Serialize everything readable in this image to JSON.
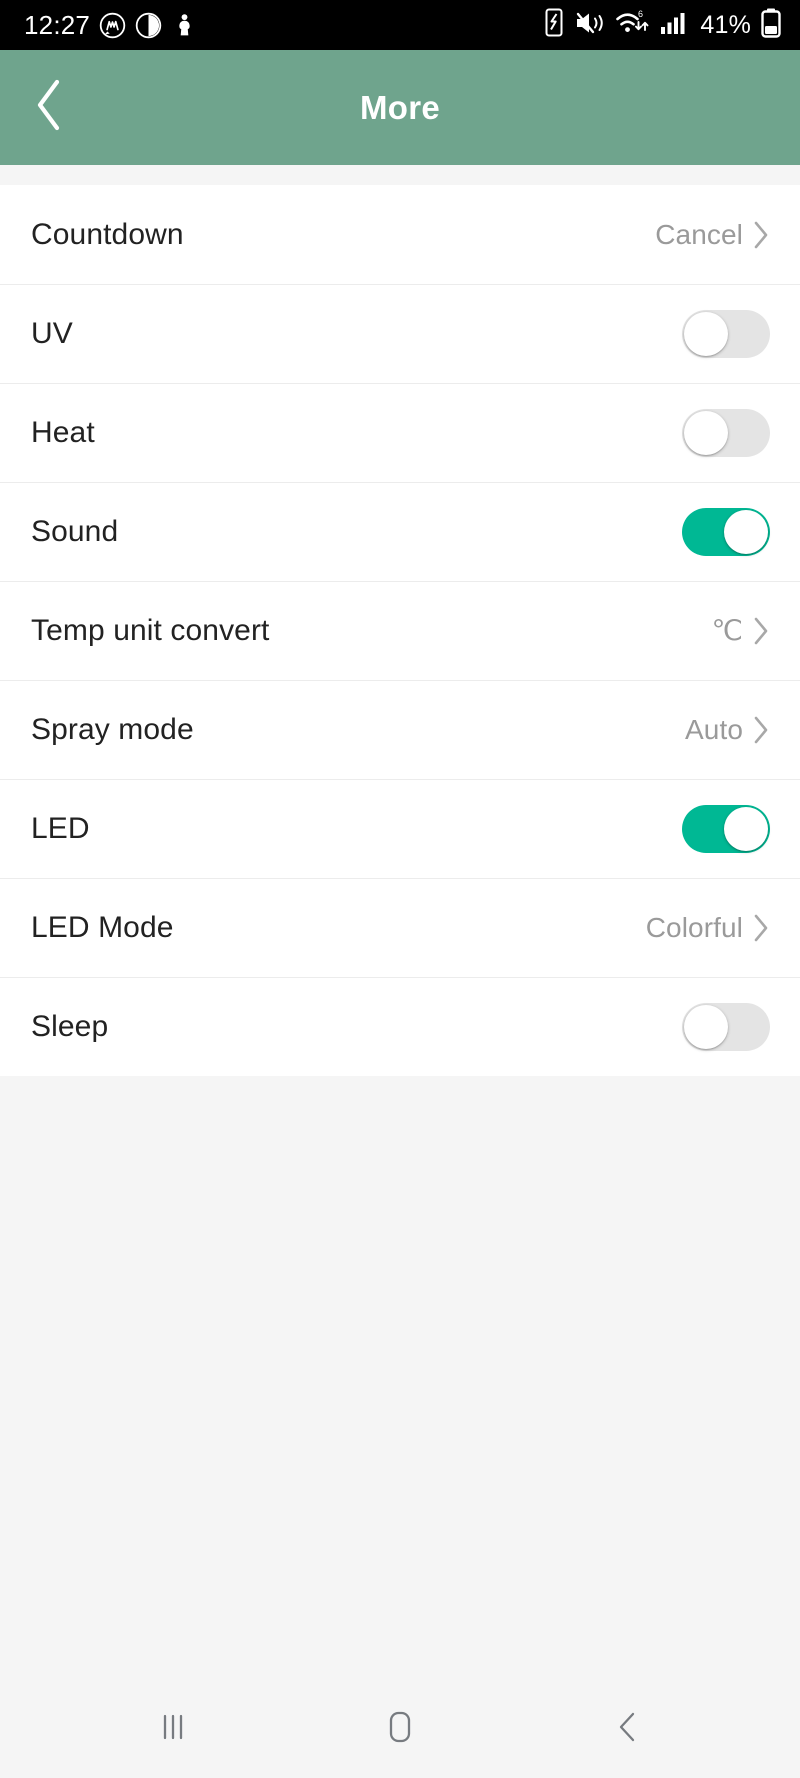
{
  "status_bar": {
    "time": "12:27",
    "battery_percent": "41%",
    "left_icons": [
      "whatsapp-icon",
      "moon-icon",
      "person-icon"
    ],
    "right_icons": [
      "nfc-icon",
      "mute-vibrate-icon",
      "wifi-icon",
      "signal-icon",
      "battery-icon"
    ]
  },
  "header": {
    "title": "More",
    "back_icon": "back-chevron-icon",
    "background_color": "#6fa48d"
  },
  "theme": {
    "accent_on_color": "#00b894",
    "toggle_off_color": "#e4e4e4",
    "label_color": "#222222",
    "value_color": "#9a9a9a"
  },
  "settings": {
    "rows": [
      {
        "label": "Countdown",
        "type": "link",
        "value": "Cancel",
        "chevron": true
      },
      {
        "label": "UV",
        "type": "toggle",
        "on": false
      },
      {
        "label": "Heat",
        "type": "toggle",
        "on": false
      },
      {
        "label": "Sound",
        "type": "toggle",
        "on": true
      },
      {
        "label": "Temp unit convert",
        "type": "link",
        "value": "℃",
        "chevron": true
      },
      {
        "label": "Spray mode",
        "type": "link",
        "value": "Auto",
        "chevron": true
      },
      {
        "label": "LED",
        "type": "toggle",
        "on": true
      },
      {
        "label": "LED Mode",
        "type": "link",
        "value": "Colorful",
        "chevron": true
      },
      {
        "label": "Sleep",
        "type": "toggle",
        "on": false
      }
    ]
  },
  "nav_bar": {
    "buttons": [
      {
        "name": "recents-button",
        "icon": "recents-icon"
      },
      {
        "name": "home-button",
        "icon": "home-icon"
      },
      {
        "name": "back-button",
        "icon": "back-chevron-icon"
      }
    ]
  }
}
